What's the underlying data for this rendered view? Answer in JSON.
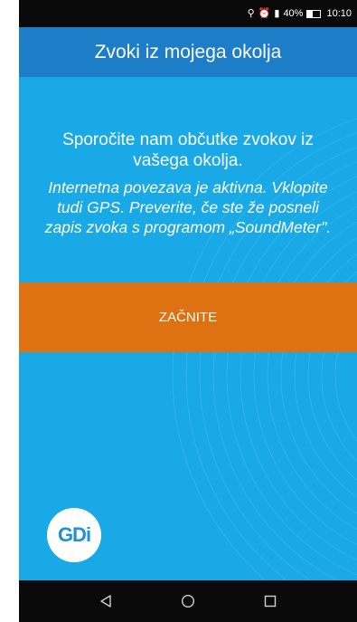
{
  "status_bar": {
    "battery": "40%",
    "time": "10:10"
  },
  "app_bar": {
    "title": "Zvoki iz mojega okolja"
  },
  "main": {
    "intro_line1": "Sporočite nam občutke zvokov iz",
    "intro_line2": "vašega okolja.",
    "hint_line1": "Internetna povezava je aktivna. Vklopite",
    "hint_line2": "tudi GPS. Preverite, če ste že posneli",
    "hint_line3": "zapis zvoka s programom „SoundMeter\".",
    "start_label": "ZAČNITE"
  },
  "logo": {
    "text": "GDi"
  },
  "nav_bar": {
    "back_icon": "back-triangle-icon",
    "home_icon": "home-circle-icon",
    "recents_icon": "recents-square-icon"
  },
  "colors": {
    "background": "#18a9e6",
    "app_bar": "#1e7dc7",
    "button": "#de7112",
    "system_bars": "#0a0a0a"
  }
}
